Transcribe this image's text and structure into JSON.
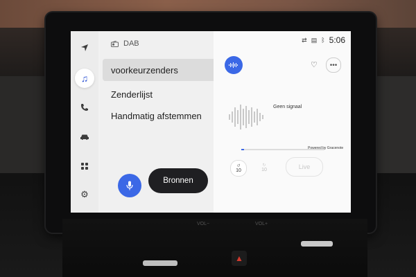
{
  "status_bar": {
    "time": "5:06",
    "icons": [
      "shuffle-icon",
      "tv-icon",
      "bluetooth-icon"
    ]
  },
  "rail": {
    "items": [
      {
        "icon": "navigation-icon"
      },
      {
        "icon": "music-icon",
        "active": true
      },
      {
        "icon": "phone-icon"
      },
      {
        "icon": "car-icon"
      },
      {
        "icon": "apps-grid-icon"
      },
      {
        "icon": "settings-gear-icon"
      }
    ]
  },
  "source": {
    "label": "DAB",
    "icon": "radio-icon"
  },
  "menu": {
    "items": [
      {
        "label": "voorkeurzenders",
        "active": true
      },
      {
        "label": "Zenderlijst"
      },
      {
        "label": "Handmatig afstemmen"
      }
    ]
  },
  "bottom": {
    "sources_button": "Bronnen",
    "mic_icon": "microphone-icon"
  },
  "now_playing": {
    "status_text": "Geen signaal",
    "powered_by": "Powered by Gracenote",
    "skip_back_label": "10",
    "skip_forward_label": "10",
    "live_label": "Live",
    "progress_fraction": 0.03
  },
  "colors": {
    "accent": "#3b68e6",
    "sources_button_bg": "#1f1f22",
    "screen_bg": "#f2f2f2"
  },
  "car_console": {
    "vol_minus": "VOL−",
    "vol_plus": "VOL+"
  }
}
